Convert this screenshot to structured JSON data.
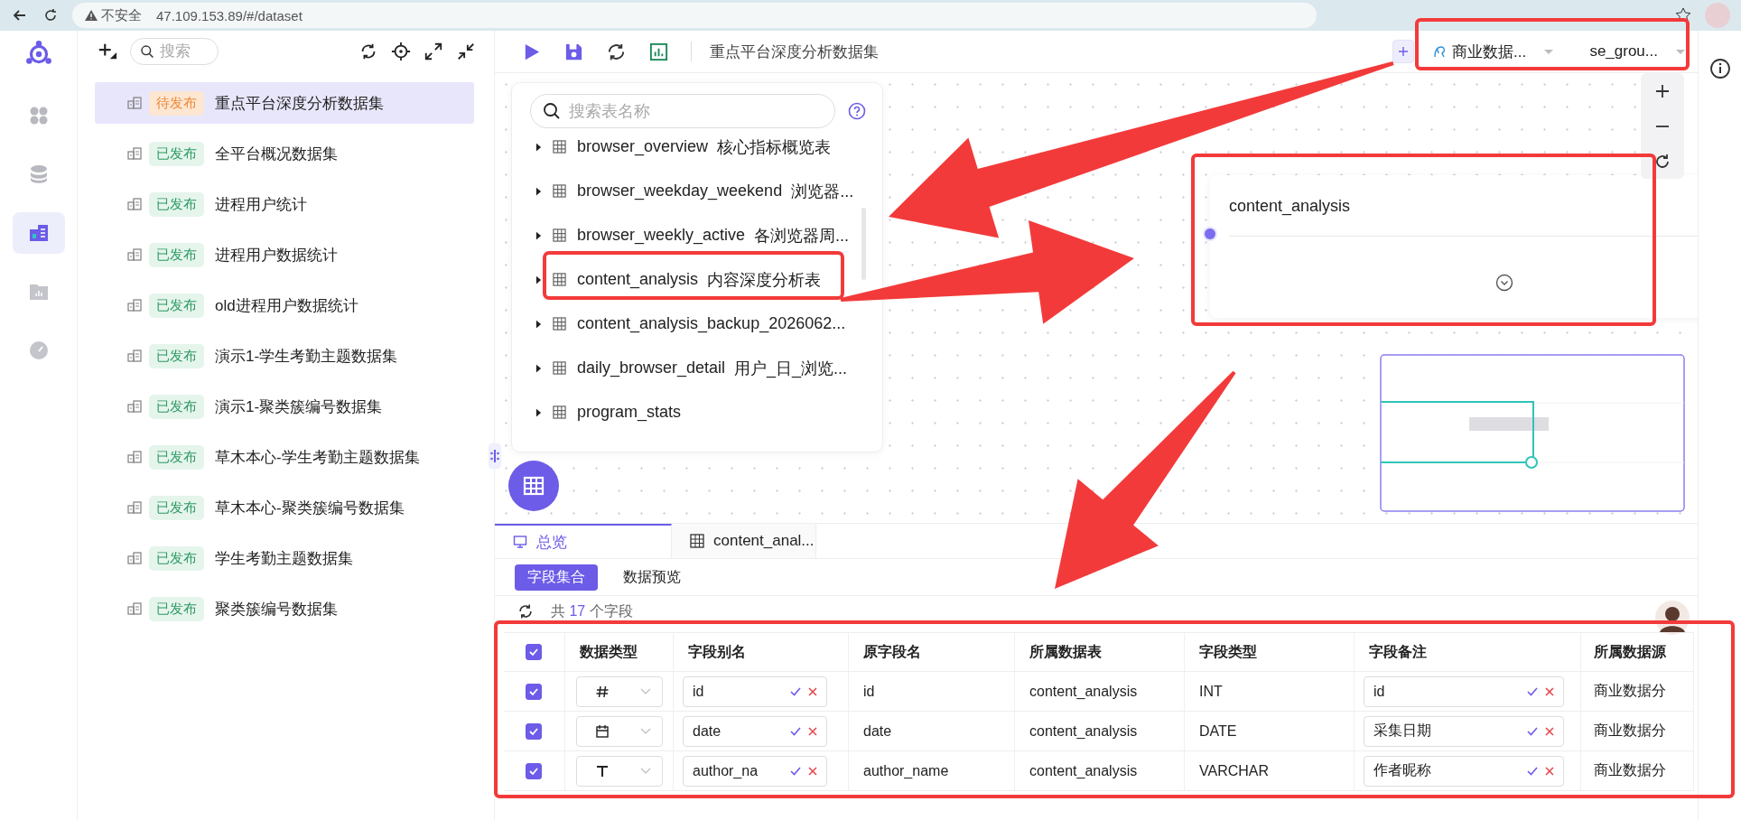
{
  "browser": {
    "security": "不安全",
    "url": "47.109.153.89/#/dataset"
  },
  "rail": [
    {
      "kind": "apps",
      "selected": false
    },
    {
      "kind": "database",
      "selected": false
    },
    {
      "kind": "dataset",
      "selected": true
    },
    {
      "kind": "report",
      "selected": false
    },
    {
      "kind": "gauge",
      "selected": false
    }
  ],
  "sidebar": {
    "search_placeholder": "搜索",
    "datasets": [
      {
        "status": "待发布",
        "kind": "pending",
        "name": "重点平台深度分析数据集",
        "selected": true
      },
      {
        "status": "已发布",
        "kind": "published",
        "name": "全平台概况数据集",
        "selected": false
      },
      {
        "status": "已发布",
        "kind": "published",
        "name": "进程用户统计",
        "selected": false
      },
      {
        "status": "已发布",
        "kind": "published",
        "name": "进程用户数据统计",
        "selected": false
      },
      {
        "status": "已发布",
        "kind": "published",
        "name": "old进程用户数据统计",
        "selected": false
      },
      {
        "status": "已发布",
        "kind": "published",
        "name": "演示1-学生考勤主题数据集",
        "selected": false
      },
      {
        "status": "已发布",
        "kind": "published",
        "name": "演示1-聚类簇编号数据集",
        "selected": false
      },
      {
        "status": "已发布",
        "kind": "published",
        "name": "草木本心-学生考勤主题数据集",
        "selected": false
      },
      {
        "status": "已发布",
        "kind": "published",
        "name": "草木本心-聚类簇编号数据集",
        "selected": false
      },
      {
        "status": "已发布",
        "kind": "published",
        "name": "学生考勤主题数据集",
        "selected": false
      },
      {
        "status": "已发布",
        "kind": "published",
        "name": "聚类簇编号数据集",
        "selected": false
      }
    ]
  },
  "toolbar": {
    "title": "重点平台深度分析数据集",
    "datasource": "商业数据...",
    "schema": "se_grou..."
  },
  "table_picker": {
    "placeholder": "搜索表名称",
    "tables": [
      {
        "name": "browser_overview",
        "comment": "核心指标概览表"
      },
      {
        "name": "browser_weekday_weekend",
        "comment": "浏览器..."
      },
      {
        "name": "browser_weekly_active",
        "comment": "各浏览器周..."
      },
      {
        "name": "content_analysis",
        "comment": "内容深度分析表"
      },
      {
        "name": "content_analysis_backup_2026062..."
      },
      {
        "name": "daily_browser_detail",
        "comment": "用户_日_浏览..."
      },
      {
        "name": "program_stats"
      }
    ]
  },
  "node": {
    "title": "content_analysis"
  },
  "bottom": {
    "tabs": [
      {
        "label": "总览",
        "kind": "overview",
        "selected": true
      },
      {
        "label": "content_anal...",
        "kind": "table",
        "selected": false
      }
    ],
    "subtabs": [
      {
        "label": "字段集合",
        "selected": true
      },
      {
        "label": "数据预览",
        "selected": false
      }
    ],
    "count_prefix": "共",
    "count": "17",
    "count_suffix": "个字段",
    "table": {
      "all_checked": true,
      "columns": [
        "数据类型",
        "字段别名",
        "原字段名",
        "所属数据表",
        "字段类型",
        "字段备注",
        "所属数据源"
      ],
      "rows": [
        {
          "checked": true,
          "kind": "number",
          "alias": "id",
          "field": "id",
          "table": "content_analysis",
          "field_type": "INT",
          "remark": "id",
          "source": "商业数据分"
        },
        {
          "checked": true,
          "kind": "date",
          "alias": "date",
          "field": "date",
          "table": "content_analysis",
          "field_type": "DATE",
          "remark": "采集日期",
          "source": "商业数据分"
        },
        {
          "checked": true,
          "kind": "text",
          "alias": "author_na",
          "field": "author_name",
          "table": "content_analysis",
          "field_type": "VARCHAR",
          "remark": "作者昵称",
          "source": "商业数据分"
        }
      ]
    }
  }
}
